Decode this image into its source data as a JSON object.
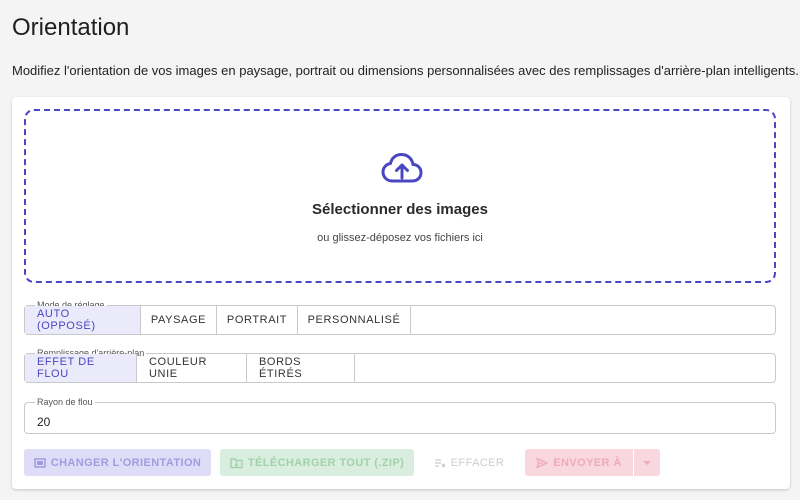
{
  "page": {
    "title": "Orientation",
    "description": "Modifiez l'orientation de vos images en paysage, portrait ou dimensions personnalisées avec des remplissages d'arrière-plan intelligents."
  },
  "dropzone": {
    "icon": "cloud-upload-icon",
    "title": "Sélectionner des images",
    "subtitle": "ou glissez-déposez vos fichiers ici"
  },
  "mode": {
    "legend": "Mode de réglage",
    "options": [
      "AUTO (OPPOSÉ)",
      "PAYSAGE",
      "PORTRAIT",
      "PERSONNALISÉ"
    ],
    "selected": "AUTO (OPPOSÉ)"
  },
  "fill": {
    "legend": "Remplissage d'arrière-plan",
    "options": [
      "EFFET DE FLOU",
      "COULEUR UNIE",
      "BORDS ÉTIRÉS"
    ],
    "selected": "EFFET DE FLOU"
  },
  "blur": {
    "legend": "Rayon de flou",
    "value": "20"
  },
  "actions": {
    "rotate": "CHANGER L'ORIENTATION",
    "download_zip": "TÉLÉCHARGER TOUT (.ZIP)",
    "clear": "EFFACER",
    "send": "ENVOYER À"
  },
  "colors": {
    "accent": "#4b47c2",
    "selected_bg": "#ebeafb"
  }
}
